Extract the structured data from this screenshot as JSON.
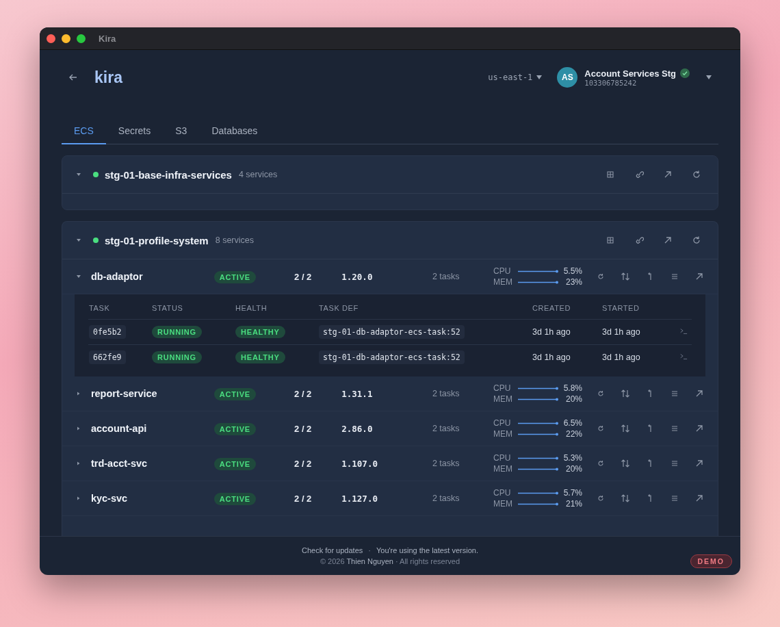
{
  "window": {
    "title": "Kira"
  },
  "header": {
    "app_title": "kira",
    "region": "us-east-1",
    "account": {
      "initials": "AS",
      "name": "Account Services Stg",
      "verified": true,
      "id": "103306785242"
    }
  },
  "tabs": [
    {
      "label": "ECS",
      "selected": true
    },
    {
      "label": "Secrets",
      "selected": false
    },
    {
      "label": "S3",
      "selected": false
    },
    {
      "label": "Databases",
      "selected": false
    }
  ],
  "groups": [
    {
      "name": "stg-01-base-infra-services",
      "count": "4 services",
      "expanded": true
    },
    {
      "name": "stg-01-profile-system",
      "count": "8 services",
      "expanded": true,
      "services": [
        {
          "name": "db-adaptor",
          "expanded": true,
          "status": "ACTIVE",
          "running": "2 / 2",
          "version": "1.20.0",
          "tasks_count": "2 tasks",
          "cpu_label": "CPU",
          "cpu": "5.5%",
          "mem_label": "MEM",
          "mem": "23%",
          "task_columns": [
            "TASK",
            "STATUS",
            "HEALTH",
            "TASK DEF",
            "CREATED",
            "STARTED"
          ],
          "tasks": [
            {
              "id": "0fe5b2",
              "status": "RUNNING",
              "health": "HEALTHY",
              "task_def": "stg-01-db-adaptor-ecs-task:52",
              "created": "3d 1h ago",
              "started": "3d 1h ago"
            },
            {
              "id": "662fe9",
              "status": "RUNNING",
              "health": "HEALTHY",
              "task_def": "stg-01-db-adaptor-ecs-task:52",
              "created": "3d 1h ago",
              "started": "3d 1h ago"
            }
          ]
        },
        {
          "name": "report-service",
          "expanded": false,
          "status": "ACTIVE",
          "running": "2 / 2",
          "version": "1.31.1",
          "tasks_count": "2 tasks",
          "cpu_label": "CPU",
          "cpu": "5.8%",
          "mem_label": "MEM",
          "mem": "20%"
        },
        {
          "name": "account-api",
          "expanded": false,
          "status": "ACTIVE",
          "running": "2 / 2",
          "version": "2.86.0",
          "tasks_count": "2 tasks",
          "cpu_label": "CPU",
          "cpu": "6.5%",
          "mem_label": "MEM",
          "mem": "22%"
        },
        {
          "name": "trd-acct-svc",
          "expanded": false,
          "status": "ACTIVE",
          "running": "2 / 2",
          "version": "1.107.0",
          "tasks_count": "2 tasks",
          "cpu_label": "CPU",
          "cpu": "5.3%",
          "mem_label": "MEM",
          "mem": "20%"
        },
        {
          "name": "kyc-svc",
          "expanded": false,
          "status": "ACTIVE",
          "running": "2 / 2",
          "version": "1.127.0",
          "tasks_count": "2 tasks",
          "cpu_label": "CPU",
          "cpu": "5.7%",
          "mem_label": "MEM",
          "mem": "21%"
        }
      ]
    }
  ],
  "footer": {
    "update_link": "Check for updates",
    "separator": "·",
    "update_status": "You're using the latest version.",
    "copyright": "© 2026 **Thien Nguyen** · All rights reserved",
    "badge": "DEMO"
  }
}
